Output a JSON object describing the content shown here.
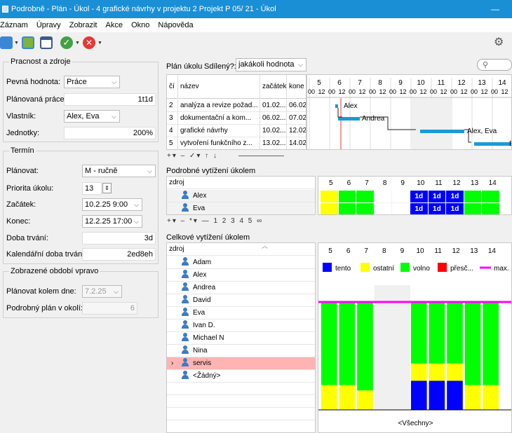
{
  "window": {
    "title": "Podrobně - Plán - Úkol - 4 grafické návrhy v projektu 2 Projekt P 05/ 21 - Úkol",
    "minimize": "—"
  },
  "menu": [
    "Záznam",
    "Úpravy",
    "Zobrazit",
    "Akce",
    "Okno",
    "Nápověda"
  ],
  "left": {
    "group1": {
      "title": "Pracnost a zdroje",
      "fixed_label": "Pevná hodnota:",
      "fixed_value": "Práce",
      "planned_work_label": "Plánovaná práce:",
      "planned_work_value": "1t1d",
      "owner_label": "Vlastník:",
      "owner_value": "Alex, Eva",
      "units_label": "Jednotky:",
      "units_value": "200%"
    },
    "group2": {
      "title": "Termín",
      "plan_label": "Plánovat:",
      "plan_value": "M - ručně",
      "priority_label": "Priorita úkolu:",
      "priority_value": "13",
      "start_label": "Začátek:",
      "start_value": "10.2.25 9:00",
      "end_label": "Konec:",
      "end_value": "12.2.25 17:00",
      "duration_label": "Doba trvání:",
      "duration_value": "3d",
      "cal_duration_label": "Kalendářní doba trvání:",
      "cal_duration_value": "2ed8eh"
    },
    "group3": {
      "title": "Zobrazené období vpravo",
      "around_label": "Plánovat kolem dne:",
      "around_value": "7.2.25",
      "detail_label": "Podrobný plán v okolí:",
      "detail_value": "6"
    }
  },
  "plan": {
    "label": "Plán úkolu",
    "shared_label": "Sdílený?:",
    "shared_value": "jakákoli hodnota",
    "cols": [
      "čí",
      "název",
      "začátek",
      "kone"
    ],
    "rows": [
      {
        "no": "2",
        "name": "analýza a revize požad...",
        "start": "01.02....",
        "end": "06.02"
      },
      {
        "no": "3",
        "name": "dokumentační a kom...",
        "start": "06.02....",
        "end": "07.02"
      },
      {
        "no": "4",
        "name": "grafické návrhy",
        "start": "10.02....",
        "end": "12.02"
      },
      {
        "no": "5",
        "name": "vytvoření funkčního z...",
        "start": "13.02....",
        "end": "14.02"
      }
    ],
    "days": [
      "5",
      "6",
      "7",
      "8",
      "9",
      "10",
      "11",
      "12",
      "13",
      "14"
    ],
    "hours": [
      "00",
      "12",
      "00",
      "12",
      "00",
      "12",
      "00",
      "12",
      "00",
      "12",
      "00",
      "12",
      "00",
      "12",
      "00",
      "12",
      "00",
      "12",
      "00",
      "12",
      "0"
    ],
    "bar_labels": [
      "Alex",
      "Andrea",
      "Alex, Eva",
      "E"
    ],
    "toolbar": "+▾ – ✓▾ ↑ ↓"
  },
  "detail": {
    "title": "Podrobné vytížení úkolem",
    "col": "zdroj",
    "rows": [
      "Alex",
      "Eva"
    ],
    "days": [
      "5",
      "6",
      "7",
      "8",
      "9",
      "10",
      "11",
      "12",
      "13",
      "14"
    ],
    "cell_text": "1d",
    "toolbar": "+▾ – *▾ — 1 2 3 4 5 ∞"
  },
  "total": {
    "title": "Celkové vytížení úkolem",
    "col": "zdroj",
    "rows": [
      "Adam",
      "Alex",
      "Andrea",
      "David",
      "Eva",
      "Ivan D.",
      "Michael N",
      "Nina",
      "servis",
      "<Žádný>"
    ],
    "days": [
      "5",
      "6",
      "7",
      "8",
      "9",
      "10",
      "11",
      "12",
      "13",
      "14"
    ],
    "legend": [
      "tento",
      "ostatní",
      "volno",
      "přesč...",
      "max."
    ],
    "footer": "<Všechny>"
  },
  "colors": {
    "blue": "#0000ff",
    "yellow": "#ffff00",
    "green": "#00ff00",
    "red": "#ff0000",
    "magenta": "#ff00ff",
    "title_bar": "#1a8fd6"
  }
}
